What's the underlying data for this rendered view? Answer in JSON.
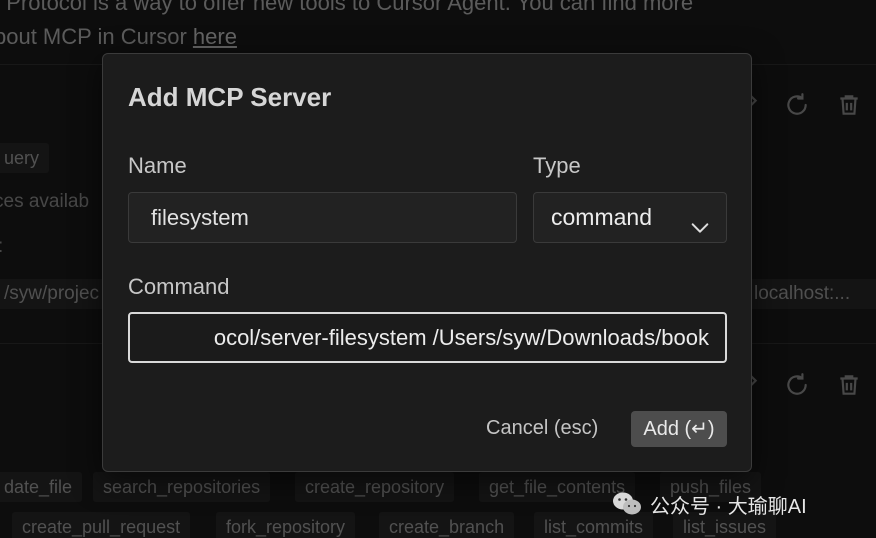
{
  "background": {
    "intro_line1": "t Protocol is a way to offer new tools to Cursor Agent. You can find more",
    "intro_line2": "bout MCP in Cursor",
    "intro_link": "here",
    "server1": {
      "tag": "uery",
      "line1": "ces availab",
      "line2": ":",
      "cmd_left": "/syw/projec",
      "cmd_right": "localhost:..."
    },
    "tools_row1": [
      "date_file",
      "search_repositories",
      "create_repository",
      "get_file_contents",
      "push_files"
    ],
    "tools_row2": [
      "create_pull_request",
      "fork_repository",
      "create_branch",
      "list_commits",
      "list_issues"
    ],
    "icons": [
      "edit-icon",
      "refresh-icon",
      "trash-icon"
    ]
  },
  "modal": {
    "title": "Add MCP Server",
    "name_label": "Name",
    "name_value": "filesystem",
    "type_label": "Type",
    "type_value": "command",
    "command_label": "Command",
    "command_value": "npx -y @modelcontextprotocol/server-filesystem /Users/syw/Downloads/book",
    "command_visible": "ocol/server-filesystem /Users/syw/Downloads/book",
    "cancel_label": "Cancel (esc)",
    "add_label": "Add (↵)"
  },
  "watermark": {
    "text": "公众号 · 大瑜聊AI"
  },
  "colors": {
    "background": "#151515",
    "modal": "#1c1c1c",
    "add_button": "#4d4d4d",
    "focus_border": "#d9d9d9"
  }
}
